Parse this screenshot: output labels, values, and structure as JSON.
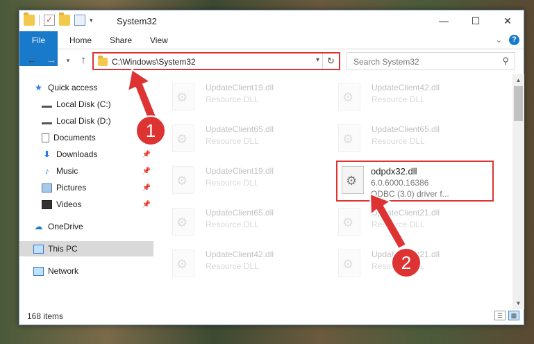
{
  "window": {
    "title": "System32",
    "controls": {
      "minimize": "—",
      "maximize": "☐",
      "close": "✕"
    }
  },
  "ribbon": {
    "tabs": [
      "File",
      "Home",
      "Share",
      "View"
    ],
    "help": "?"
  },
  "nav": {
    "address": "C:\\Windows\\System32",
    "search_placeholder": "Search System32"
  },
  "sidebar": {
    "items": [
      {
        "label": "Quick access",
        "icon": "star-icon",
        "pinned": false
      },
      {
        "label": "Local Disk (C:)",
        "icon": "drive-icon",
        "pinned": true
      },
      {
        "label": "Local Disk (D:)",
        "icon": "drive-icon",
        "pinned": false
      },
      {
        "label": "Documents",
        "icon": "documents-icon",
        "pinned": true
      },
      {
        "label": "Downloads",
        "icon": "download-icon",
        "pinned": true
      },
      {
        "label": "Music",
        "icon": "music-icon",
        "pinned": true
      },
      {
        "label": "Pictures",
        "icon": "pictures-icon",
        "pinned": true
      },
      {
        "label": "Videos",
        "icon": "videos-icon",
        "pinned": true
      },
      {
        "label": "OneDrive",
        "icon": "cloud-icon",
        "pinned": false
      },
      {
        "label": "This PC",
        "icon": "computer-icon",
        "pinned": false,
        "selected": true
      },
      {
        "label": "Network",
        "icon": "network-icon",
        "pinned": false
      }
    ]
  },
  "files": [
    {
      "name": "UpdateClient19.dll",
      "desc": "Resource DLL"
    },
    {
      "name": "UpdateClient42.dll",
      "desc": "Resource DLL"
    },
    {
      "name": "UpdateClient65.dll",
      "desc": "Resource DLL"
    },
    {
      "name": "UpdateClient65.dll",
      "desc": "Resource DLL"
    },
    {
      "name": "UpdateClient19.dll",
      "desc": "Resource DLL"
    },
    {
      "name": "UpdateClient65.dll",
      "desc": "Resource DLL"
    },
    {
      "name": "UpdateClient21.dll",
      "desc": "Resource DLL"
    },
    {
      "name": "UpdateClient42.dll",
      "desc": "Resource DLL"
    },
    {
      "name": "UpdateClient21.dll",
      "desc": "Resource DLL"
    }
  ],
  "highlighted_file": {
    "name": "odpdx32.dll",
    "version": "6.0.6000.16386",
    "desc": "ODBC (3.0) driver f..."
  },
  "status": {
    "count": "168 items"
  },
  "annotations": {
    "step1": "1",
    "step2": "2",
    "color": "#dd3333"
  }
}
